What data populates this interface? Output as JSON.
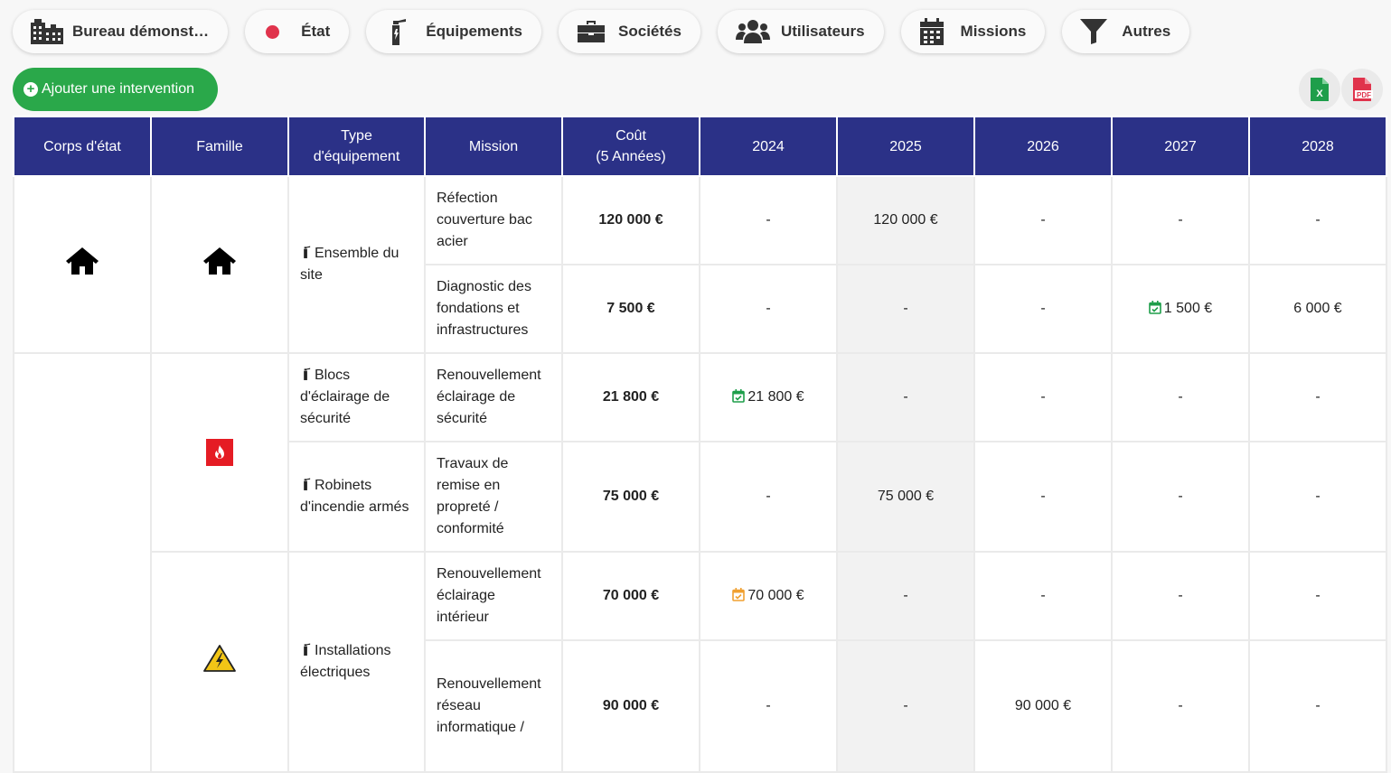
{
  "filters": [
    {
      "label": "Bureau démonst…",
      "icon": "building-icon"
    },
    {
      "label": "État",
      "icon": "status-dot-icon"
    },
    {
      "label": "Équipements",
      "icon": "fire-extinguisher-icon"
    },
    {
      "label": "Sociétés",
      "icon": "briefcase-icon"
    },
    {
      "label": "Utilisateurs",
      "icon": "users-icon"
    },
    {
      "label": "Missions",
      "icon": "calendar-icon"
    },
    {
      "label": "Autres",
      "icon": "filter-icon"
    }
  ],
  "add_button": {
    "label": "Ajouter une intervention"
  },
  "exports": [
    {
      "label": "X",
      "icon": "excel-icon",
      "color": "#1e9e4a"
    },
    {
      "label": "PDF",
      "icon": "pdf-icon",
      "color": "#e0334c"
    }
  ],
  "table": {
    "headers": [
      "Corps d'état",
      "Famille",
      "Type d'équipement",
      "Mission",
      "Coût (5 Années)",
      "2024",
      "2025",
      "2026",
      "2027",
      "2028"
    ],
    "cost_header": {
      "line1": "Coût",
      "line2": "(5 Années)"
    },
    "type_header": {
      "line1": "Type",
      "line2": "d'équipement"
    },
    "groups": [
      {
        "types": [
          {
            "label": "Ensemble du site",
            "missions": [
              {
                "name": "Réfection couverture bac acier",
                "cost": "120 000 €",
                "years": [
                  "-",
                  "120 000 €",
                  "-",
                  "-",
                  "-"
                ]
              },
              {
                "name": "Diagnostic des fondations et infrastructures",
                "cost": "7 500 €",
                "years": [
                  "-",
                  "-",
                  "-",
                  "1 500 €",
                  "6 000 €"
                ]
              }
            ]
          }
        ]
      },
      {
        "types": [
          {
            "label": "Blocs d'éclairage de sécurité",
            "missions": [
              {
                "name": "Renouvellement éclairage de sécurité",
                "cost": "21 800 €",
                "years": [
                  "21 800 €",
                  "-",
                  "-",
                  "-",
                  "-"
                ]
              }
            ]
          },
          {
            "label": "Robinets d'incendie armés",
            "missions": [
              {
                "name": "Travaux de remise en propreté / conformité",
                "cost": "75 000 €",
                "years": [
                  "-",
                  "75 000 €",
                  "-",
                  "-",
                  "-"
                ]
              }
            ]
          },
          {
            "label": "Installations électriques",
            "missions": [
              {
                "name": "Renouvellement éclairage intérieur",
                "cost": "70 000 €",
                "years": [
                  "70 000 €",
                  "-",
                  "-",
                  "-",
                  "-"
                ]
              },
              {
                "name": "Renouvellement réseau informatique /",
                "cost": "90 000 €",
                "years": [
                  "-",
                  "-",
                  "90 000 €",
                  "-",
                  "-"
                ]
              }
            ]
          }
        ]
      }
    ]
  },
  "colors": {
    "header_bg": "#2b3187",
    "add_green": "#2aa84a",
    "cal_green": "#1e9e4a",
    "cal_orange": "#f0a030",
    "fire_red": "#e51c24",
    "elec_yellow": "#f2c516"
  }
}
